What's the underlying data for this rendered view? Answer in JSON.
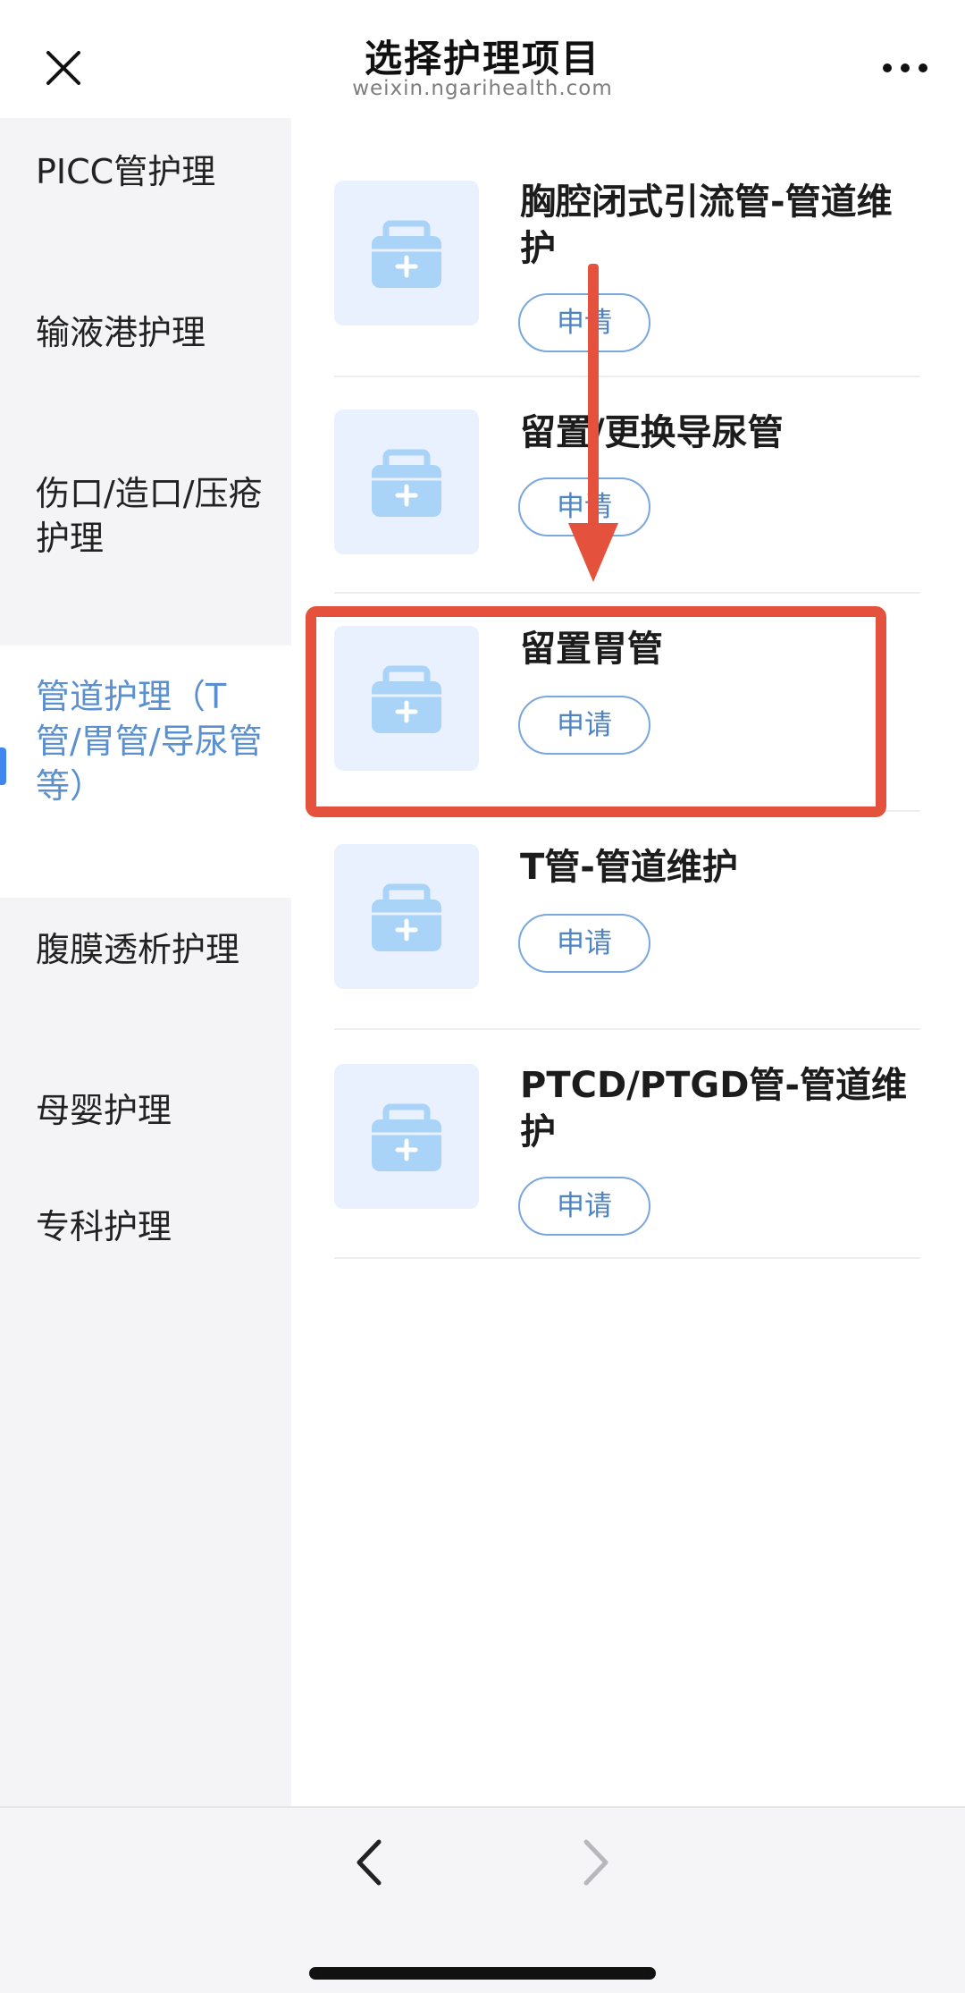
{
  "header": {
    "title": "选择护理项目",
    "subtitle": "weixin.ngarihealth.com",
    "close_icon": "close-icon",
    "more_icon": "more-dots-icon"
  },
  "sidebar": {
    "items": [
      {
        "label": "PICC管护理",
        "selected": false
      },
      {
        "label": "输液港护理",
        "selected": false
      },
      {
        "label": "伤口/造口/压疮护理",
        "selected": false
      },
      {
        "label": "管道护理（T管/胃管/导尿管等）",
        "selected": true
      },
      {
        "label": "腹膜透析护理",
        "selected": false
      },
      {
        "label": "母婴护理",
        "selected": false
      },
      {
        "label": "专科护理",
        "selected": false
      }
    ]
  },
  "items": [
    {
      "title": "胸腔闭式引流管-管道维护",
      "button": "申请",
      "icon": "medical-kit-icon"
    },
    {
      "title": "留置/更换导尿管",
      "button": "申请",
      "icon": "medical-kit-icon"
    },
    {
      "title": "留置胃管",
      "button": "申请",
      "icon": "medical-kit-icon"
    },
    {
      "title": "T管-管道维护",
      "button": "申请",
      "icon": "medical-kit-icon"
    },
    {
      "title": "PTCD/PTGD管-管道维护",
      "button": "申请",
      "icon": "medical-kit-icon"
    }
  ],
  "annotation": {
    "highlighted_item": "留置胃管",
    "color": "#e4513c"
  },
  "footer": {
    "back_icon": "chevron-left-icon",
    "forward_icon": "chevron-right-icon",
    "forward_enabled": false
  },
  "colors": {
    "accent": "#5a8fd0",
    "indicator": "#3f86f0",
    "button_border": "#79a7de",
    "sidebar_bg": "#f4f4f6"
  }
}
